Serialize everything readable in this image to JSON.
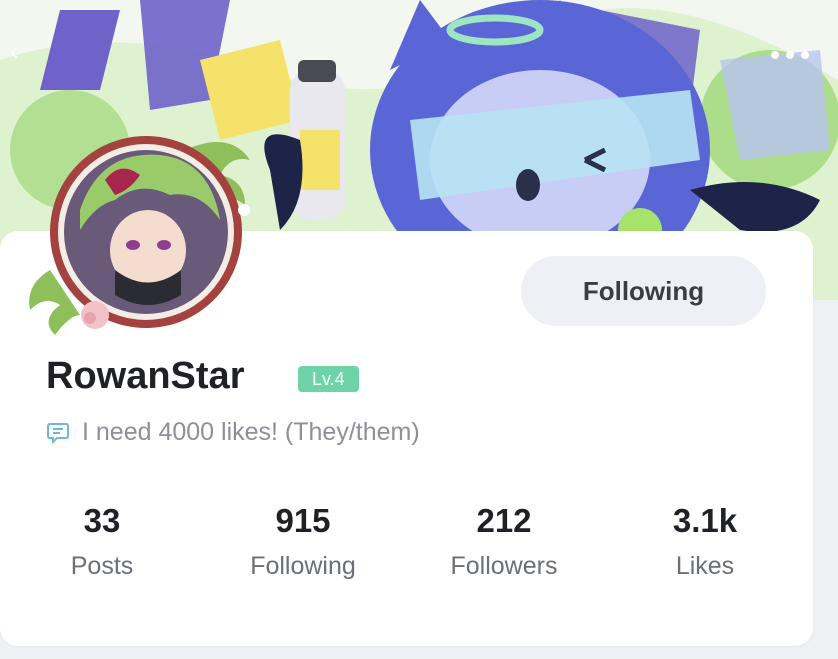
{
  "header": {
    "back_icon": "chevron-left-icon",
    "more_icon": "more-dots-icon"
  },
  "profile": {
    "username": "RowanStar",
    "level": "Lv.4",
    "bio": "I need 4000 likes! (They/them)",
    "bio_icon": "comment-icon",
    "follow_button": "Following",
    "accent_color": "#6fd3a8"
  },
  "stats": [
    {
      "value": "33",
      "label": "Posts"
    },
    {
      "value": "915",
      "label": "Following"
    },
    {
      "value": "212",
      "label": "Followers"
    },
    {
      "value": "3.1k",
      "label": "Likes"
    }
  ]
}
